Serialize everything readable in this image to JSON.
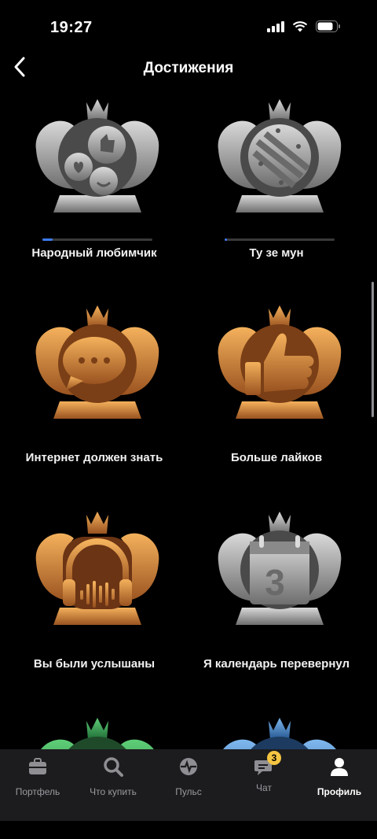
{
  "status_bar": {
    "time": "19:27"
  },
  "nav": {
    "title": "Достижения"
  },
  "achievements": [
    {
      "label": "Народный любимчик",
      "tier": "silver",
      "icon": "reactions-icon",
      "progress": 0.09
    },
    {
      "label": "Ту зе мун",
      "tier": "silver",
      "icon": "rocket-icon",
      "progress": 0.02
    },
    {
      "label": "Интернет должен знать",
      "tier": "bronze",
      "icon": "chat-bubbles-icon"
    },
    {
      "label": "Больше лайков",
      "tier": "bronze",
      "icon": "thumbs-up-icon"
    },
    {
      "label": "Вы были услышаны",
      "tier": "bronze",
      "icon": "headphones-icon"
    },
    {
      "label": "Я календарь перевернул",
      "tier": "silver",
      "icon": "calendar-icon",
      "calendar_number": "3"
    },
    {
      "tier": "green"
    },
    {
      "tier": "blue"
    }
  ],
  "tabbar": {
    "items": [
      {
        "label": "Портфель",
        "icon": "briefcase-icon"
      },
      {
        "label": "Что купить",
        "icon": "search-icon"
      },
      {
        "label": "Пульс",
        "icon": "pulse-icon"
      },
      {
        "label": "Чат",
        "icon": "chat-icon",
        "badge": "3"
      },
      {
        "label": "Профиль",
        "icon": "profile-icon",
        "active": true
      }
    ]
  },
  "colors": {
    "accent": "#3d7bf2",
    "badge": "#f5c542",
    "silver": "#a9a9a9",
    "bronze": "#d8893a"
  }
}
